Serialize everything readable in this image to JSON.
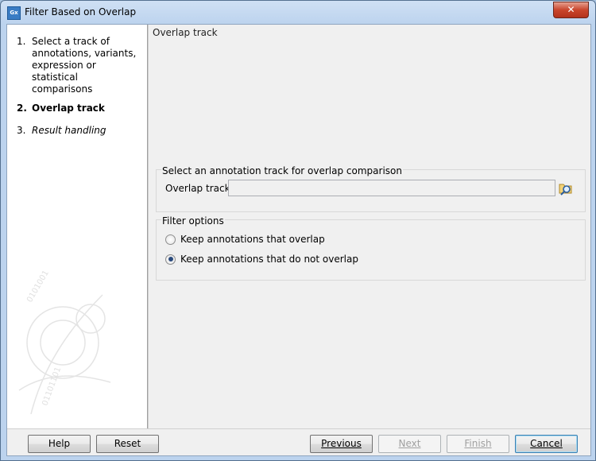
{
  "window": {
    "title": "Filter Based on Overlap",
    "app_icon_text": "Gx",
    "close_label": "✕"
  },
  "steps": [
    {
      "num": "1.",
      "label": "Select a track of annotations, variants, expression or statistical comparisons",
      "state": "done"
    },
    {
      "num": "2.",
      "label": "Overlap track",
      "state": "active"
    },
    {
      "num": "3.",
      "label": "Result handling",
      "state": "future"
    }
  ],
  "panel": {
    "title": "Overlap track",
    "annotation_group": {
      "title": "Select an annotation track for overlap comparison",
      "field_label": "Overlap track",
      "field_value": "",
      "browse_icon": "folder-search-icon"
    },
    "filter_group": {
      "title": "Filter options",
      "options": [
        {
          "label": "Keep annotations that overlap",
          "checked": false
        },
        {
          "label": "Keep annotations that do not overlap",
          "checked": true
        }
      ]
    }
  },
  "buttons": {
    "help": "Help",
    "reset": "Reset",
    "previous": "Previous",
    "next": "Next",
    "finish": "Finish",
    "cancel": "Cancel"
  },
  "colors": {
    "title_bar": "#bcd3ee",
    "close_button": "#c9452c",
    "radio_dot": "#2a4a7d"
  }
}
